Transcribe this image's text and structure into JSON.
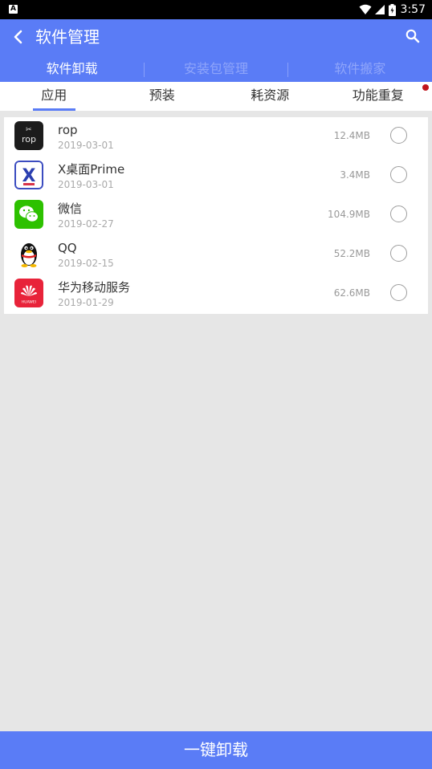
{
  "status_bar": {
    "time": "3:57",
    "notification_icon": "A"
  },
  "app_bar": {
    "title": "软件管理"
  },
  "top_tabs": [
    "软件卸载",
    "安装包管理",
    "软件搬家"
  ],
  "sub_tabs": [
    "应用",
    "预装",
    "耗资源",
    "功能重复"
  ],
  "apps": [
    {
      "name": "rop",
      "date": "2019-03-01",
      "size": "12.4MB",
      "icon": "rop-app-icon",
      "icon_text": "rop"
    },
    {
      "name": "X桌面Prime",
      "date": "2019-03-01",
      "size": "3.4MB",
      "icon": "x-launcher-icon",
      "icon_text": "X"
    },
    {
      "name": "微信",
      "date": "2019-02-27",
      "size": "104.9MB",
      "icon": "wechat-icon"
    },
    {
      "name": "QQ",
      "date": "2019-02-15",
      "size": "52.2MB",
      "icon": "qq-penguin-icon"
    },
    {
      "name": "华为移动服务",
      "date": "2019-01-29",
      "size": "62.6MB",
      "icon": "huawei-icon",
      "icon_text": "HUAWEI"
    }
  ],
  "bottom_button": "一键卸载",
  "colors": {
    "accent": "#5a7cf6",
    "badge": "#c0141c"
  }
}
